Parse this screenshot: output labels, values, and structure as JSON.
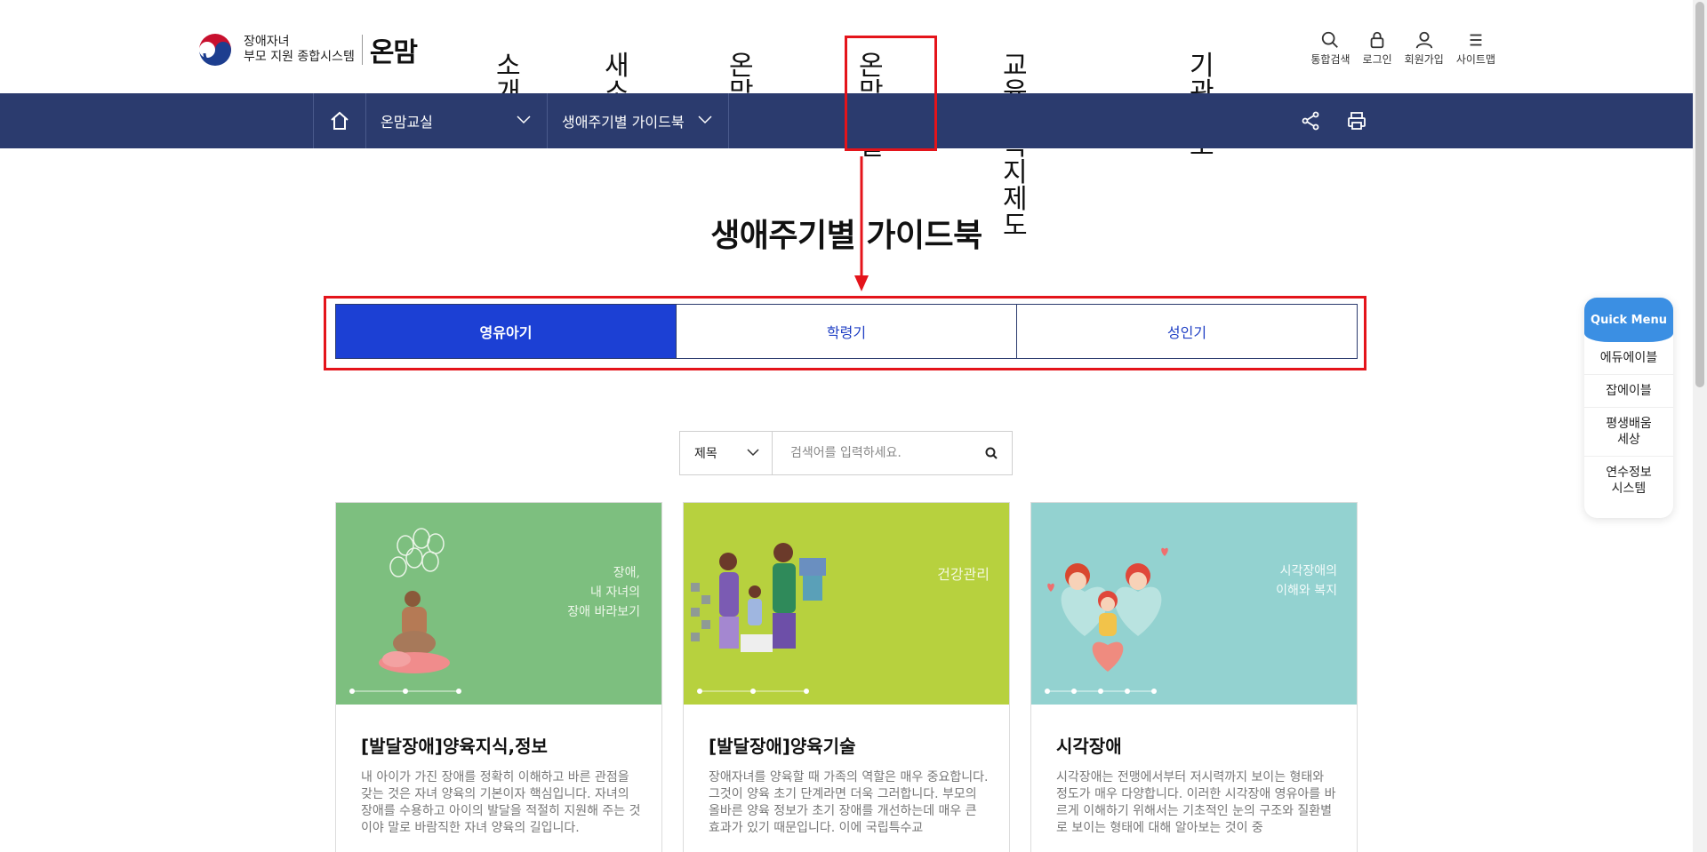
{
  "logo": {
    "line1": "장애자녀",
    "line2": "부모 지원 종합시스템",
    "brand": "온맘"
  },
  "gnb": [
    {
      "label": "소\n개"
    },
    {
      "label": "새소\n식"
    },
    {
      "label": "온맘\nTV"
    },
    {
      "label": "온맘\n교실"
    },
    {
      "label": "교육·복지\n제도"
    },
    {
      "label": "기관\n정보"
    }
  ],
  "util": {
    "search": "통합검색",
    "login": "로그인",
    "join": "회원가입",
    "sitemap": "사이트맵"
  },
  "location": {
    "depth1": "온맘교실",
    "depth2": "생애주기별 가이드북"
  },
  "page": {
    "title": "생애주기별 가이드북"
  },
  "tabs": [
    {
      "label": "영유아기",
      "active": true
    },
    {
      "label": "학령기",
      "active": false
    },
    {
      "label": "성인기",
      "active": false
    }
  ],
  "search": {
    "select_value": "제목",
    "placeholder": "검색어를 입력하세요."
  },
  "cards": [
    {
      "cover_text": "장애,\n내 자녀의\n장애 바라보기",
      "title": "[발달장애]양육지식,정보",
      "desc": "내 아이가 가진 장애를 정확히 이해하고 바른 관점을 갖는 것은 자녀 양육의 기본이자 핵심입니다. 자녀의 장애를 수용하고 아이의 발달을 적절히 지원해 주는 것이야 말로 바람직한 자녀 양육의 길입니다."
    },
    {
      "cover_text": "건강관리",
      "title": "[발달장애]양육기술",
      "desc": "장애자녀를 양육할 때 가족의 역할은 매우 중요합니다. 그것이 양육 초기 단계라면 더욱 그러합니다. 부모의 올바른 양육 정보가 초기 장애를 개선하는데 매우 큰 효과가 있기 때문입니다. 이에 국립특수교"
    },
    {
      "cover_text": "시각장애의\n이해와 복지",
      "title": "시각장애",
      "desc": "시각장애는 전맹에서부터 저시력까지 보이는 형태와 정도가 매우 다양합니다. 이러한 시각장애 영유아를 바르게 이해하기 위해서는 기초적인 눈의 구조와 질환별로 보이는 형태에 대해 알아보는 것이 중"
    }
  ],
  "quick": {
    "title": "Quick Menu",
    "items": [
      "에듀에이블",
      "잡에이블",
      "평생배움\n세상",
      "연수정보\n시스템"
    ]
  },
  "colors": {
    "navy": "#2b3b6e",
    "tab_active": "#1c40d4",
    "annotation": "#e4141b",
    "quick_head": "#3b8fe3"
  }
}
